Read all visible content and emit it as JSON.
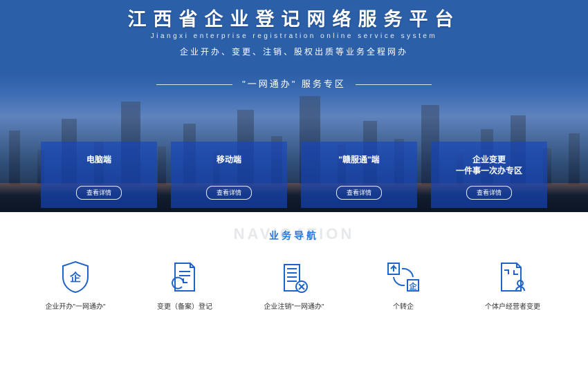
{
  "hero": {
    "title": "江西省企业登记网络服务平台",
    "subtitle_en": "Jiangxi enterprise registration online service system",
    "subtitle_cn": "企业开办、变更、注销、股权出质等业务全程网办",
    "zone_label": "\"一网通办\" 服务专区",
    "detail_label": "查看详情",
    "cards": [
      {
        "title": "电脑端"
      },
      {
        "title": "移动端"
      },
      {
        "title": "\"赣服通\"端"
      },
      {
        "title": "企业变更\n一件事一次办专区"
      }
    ]
  },
  "navigation": {
    "bg_text": "NAVIGATION",
    "heading": "业务导航",
    "items": [
      {
        "label": "企业开办\"一网通办\""
      },
      {
        "label": "变更（备案）登记"
      },
      {
        "label": "企业注销\"一网通办\""
      },
      {
        "label": "个转企"
      },
      {
        "label": "个体户经营者变更"
      }
    ]
  }
}
